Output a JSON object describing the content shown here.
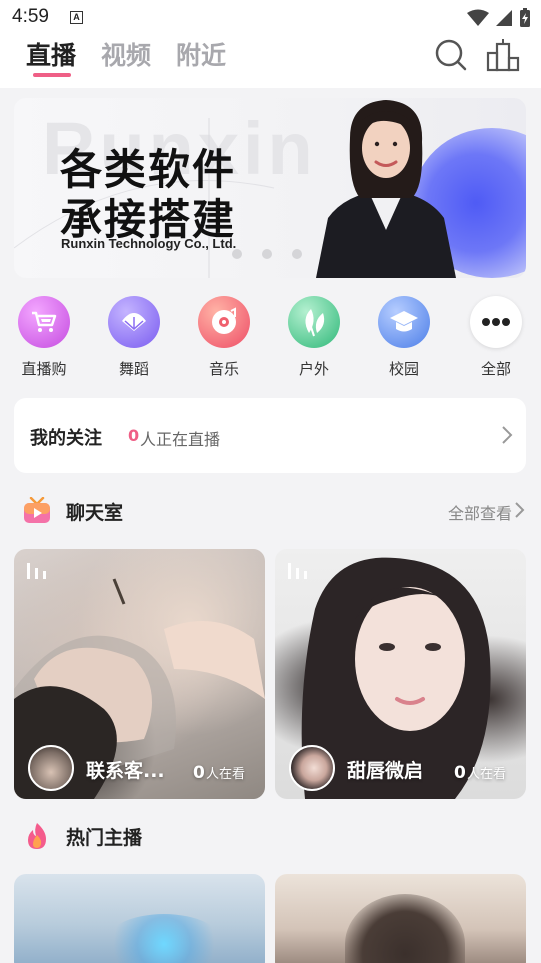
{
  "status_bar": {
    "time": "4:59",
    "notification": "A"
  },
  "top_nav": {
    "tabs": [
      {
        "label": "直播",
        "active": true
      },
      {
        "label": "视频",
        "active": false
      },
      {
        "label": "附近",
        "active": false
      }
    ],
    "accent": "#ef5f86"
  },
  "banner": {
    "bg_text": "Runxin",
    "line1": "各类软件",
    "line2": "承接搭建",
    "company": "Runxin Technology Co., Ltd.",
    "slide_count": 3
  },
  "categories": [
    {
      "label": "直播购",
      "icon": "shopping-cart-icon",
      "color": "#d65be8"
    },
    {
      "label": "舞蹈",
      "icon": "fan-icon",
      "color": "#8b6cf2"
    },
    {
      "label": "音乐",
      "icon": "record-icon",
      "color": "#f0606e"
    },
    {
      "label": "户外",
      "icon": "leaf-icon",
      "color": "#46c98a"
    },
    {
      "label": "校园",
      "icon": "graduation-cap-icon",
      "color": "#5f8ff1"
    },
    {
      "label": "全部",
      "icon": "more-icon",
      "color": "#ffffff"
    }
  ],
  "follow": {
    "title": "我的关注",
    "count": "0",
    "text": "人正在直播"
  },
  "chatroom": {
    "title": "聊天室",
    "more": "全部查看",
    "cards": [
      {
        "name": "联系客...",
        "count": "0",
        "watch": "人在看"
      },
      {
        "name": "甜唇微启",
        "count": "0",
        "watch": "人在看"
      }
    ]
  },
  "hot": {
    "title": "热门主播"
  }
}
